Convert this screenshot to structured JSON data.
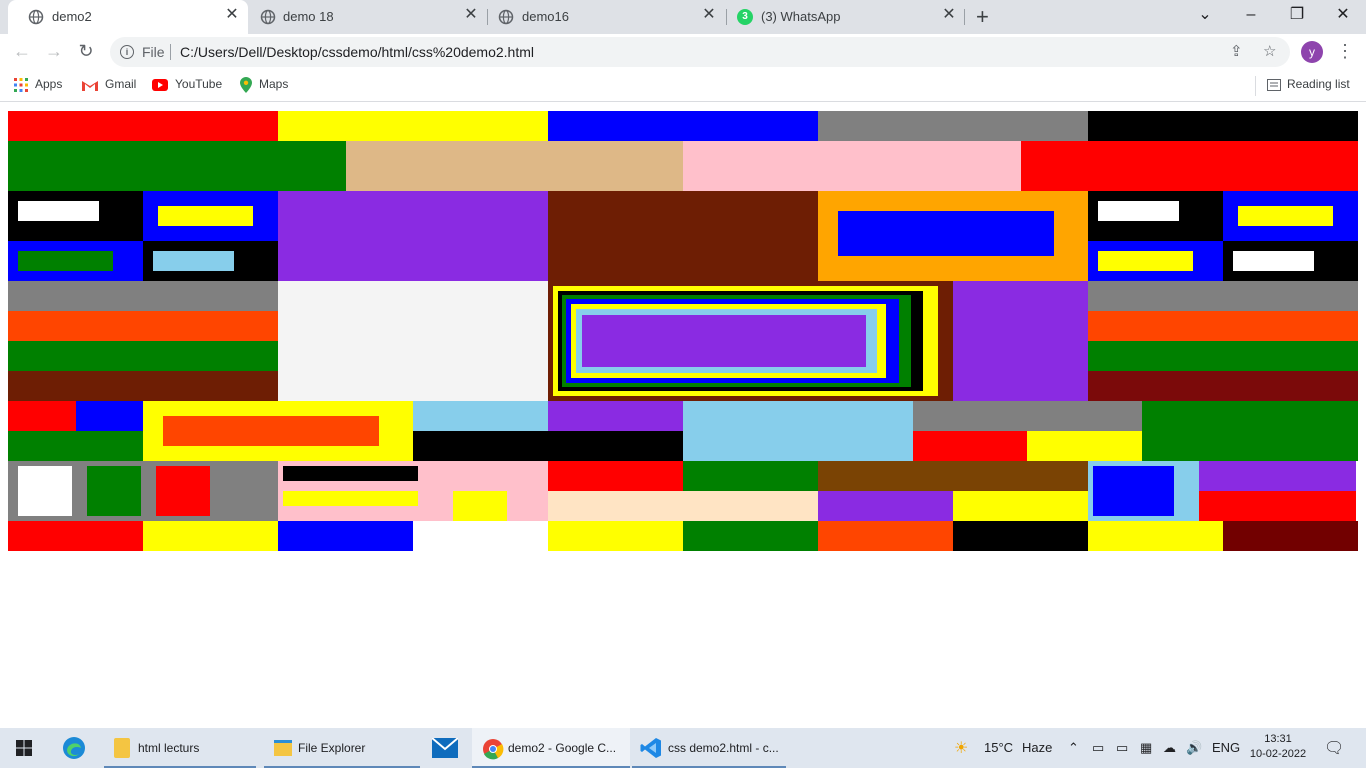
{
  "browser": {
    "tabs": [
      {
        "label": "demo2",
        "active": true
      },
      {
        "label": "demo 18",
        "active": false
      },
      {
        "label": "demo16",
        "active": false
      },
      {
        "label": "(3) WhatsApp",
        "active": false
      }
    ],
    "whatsapp_badge": "3",
    "address": {
      "scheme_label": "File",
      "url": "C:/Users/Dell/Desktop/cssdemo/html/css%20demo2.html"
    },
    "profile_initial": "y",
    "bookmarks": [
      {
        "label": "Apps",
        "icon": "apps-grid-icon"
      },
      {
        "label": "Gmail",
        "icon": "gmail-icon"
      },
      {
        "label": "YouTube",
        "icon": "youtube-icon"
      },
      {
        "label": "Maps",
        "icon": "maps-icon"
      }
    ],
    "reading_list": "Reading list"
  },
  "taskbar": {
    "items": [
      {
        "label": "html lecturs",
        "icon": "folder-icon"
      },
      {
        "label": "File Explorer",
        "icon": "file-explorer-icon"
      },
      {
        "label": "demo2 - Google C...",
        "icon": "chrome-icon"
      },
      {
        "label": "css demo2.html - c...",
        "icon": "vscode-icon"
      }
    ],
    "weather": {
      "temp": "15°C",
      "condition": "Haze"
    },
    "language": "ENG",
    "time": "13:31",
    "date": "10-02-2022"
  },
  "colors": {
    "red": "#ff0000",
    "yellow": "#ffff00",
    "blue": "#0000ff",
    "gray": "#808080",
    "black": "#000000",
    "green": "#008000",
    "tan": "#deb887",
    "pink": "#ffc0cb",
    "white": "#ffffff",
    "purple": "#8a2be2",
    "brown": "#6e1e04",
    "orange": "#ffa500",
    "skyblue": "#87ceeb",
    "orangered": "#ff4500",
    "darkred": "#7b0a0a",
    "whitesmoke": "#f4f4f4",
    "bisque": "#ffe4c4",
    "saddlebrown": "#7a4304",
    "maroon": "#720000"
  }
}
